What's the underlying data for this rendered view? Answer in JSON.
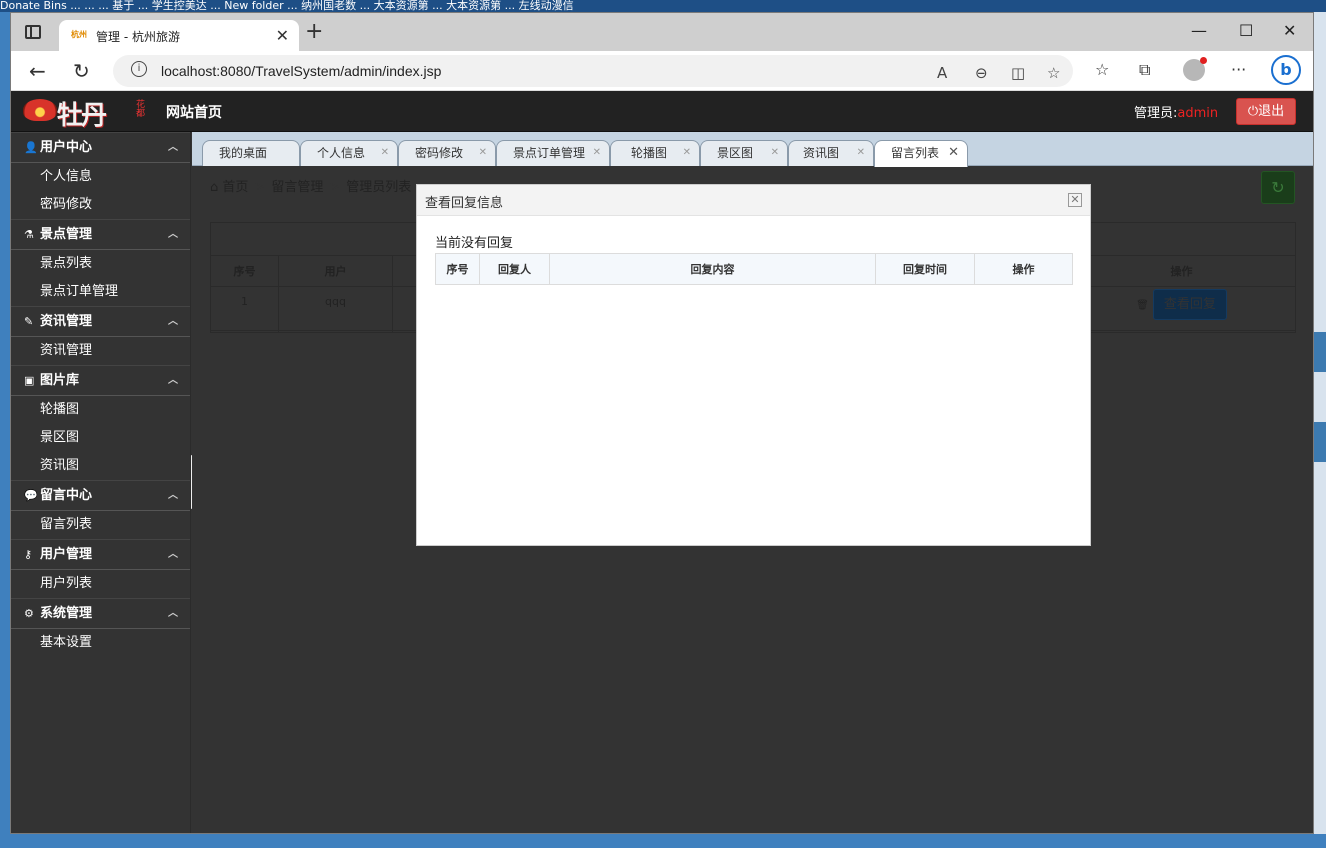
{
  "browser": {
    "tab_title": "管理 - 杭州旅游",
    "favicon_text": "杭州",
    "url": "localhost:8080/TravelSystem/admin/index.jsp"
  },
  "header": {
    "logo_text": "牡丹",
    "logo_seal": "花都",
    "site_title": "网站首页",
    "admin_label": "管理员:",
    "admin_name": "admin",
    "logout_label": "退出"
  },
  "sidebar": {
    "groups": [
      {
        "title": "用户中心",
        "icon": "user-icon",
        "items": [
          "个人信息",
          "密码修改"
        ]
      },
      {
        "title": "景点管理",
        "icon": "flask-icon",
        "items": [
          "景点列表",
          "景点订单管理"
        ]
      },
      {
        "title": "资讯管理",
        "icon": "edit-icon",
        "items": [
          "资讯管理"
        ]
      },
      {
        "title": "图片库",
        "icon": "image-icon",
        "items": [
          "轮播图",
          "景区图",
          "资讯图"
        ]
      },
      {
        "title": "留言中心",
        "icon": "comments-icon",
        "items": [
          "留言列表"
        ]
      },
      {
        "title": "用户管理",
        "icon": "key-icon",
        "items": [
          "用户列表"
        ]
      },
      {
        "title": "系统管理",
        "icon": "cogs-icon",
        "items": [
          "基本设置"
        ]
      }
    ]
  },
  "tabs": [
    "我的桌面",
    "个人信息",
    "密码修改",
    "景点订单管理",
    "轮播图",
    "景区图",
    "资讯图",
    "留言列表"
  ],
  "breadcrumb": {
    "home": "首页",
    "level1": "留言管理",
    "level2": "管理员列表"
  },
  "bg_table": {
    "headers": [
      "序号",
      "用户",
      "操作"
    ],
    "row": {
      "index": "1",
      "user": "qqq",
      "action": "查看回复"
    }
  },
  "modal": {
    "title": "查看回复信息",
    "empty_text": "当前没有回复",
    "headers": [
      "序号",
      "回复人",
      "回复内容",
      "回复时间",
      "操作"
    ]
  },
  "desktop_text": "Donate Bins  ...  ... ... 基于 ... 学生控美达 ... New folder ... 纳州国老数 ... 大本资源第 ... 大本资源第 ... 左线动漫信"
}
